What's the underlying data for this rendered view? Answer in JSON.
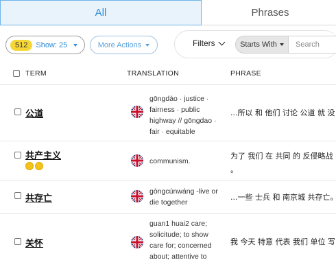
{
  "tabs": {
    "all": "All",
    "phrases": "Phrases"
  },
  "toolbar": {
    "count": "512",
    "show_label": "Show: 25",
    "more_actions": "More Actions",
    "filters": "Filters",
    "starts_with": "Starts With",
    "search_placeholder": "Search"
  },
  "columns": {
    "term": "TERM",
    "translation": "TRANSLATION",
    "phrase": "PHRASE"
  },
  "rows": [
    {
      "term": "公道",
      "translation": [
        "gōngdào · justice ·",
        "fairness · public",
        "highway // gōngdao ·",
        "fair · equitable"
      ],
      "phrase": [
        "...所以 和 他们 讨论 公道 就 没"
      ]
    },
    {
      "term": "共产主义",
      "translation": [
        "communism."
      ],
      "phrase": [
        "为了 我们 在 共同 的 反侵略战",
        "。"
      ]
    },
    {
      "term": "共存亡",
      "translation": [
        "gòngcúnwáng -live or",
        "die together"
      ],
      "phrase": [
        "...一些 士兵 和 南京城 共存亡。"
      ]
    },
    {
      "term": "关怀",
      "translation": [
        "guan1 huai2 care;",
        "solicitude; to show",
        "care for; concerned",
        "about; attentive to"
      ],
      "phrase": [
        "我 今天 特意 代表 我们 单位 写"
      ]
    }
  ],
  "colors": {
    "accent": "#2a8ad8",
    "badge": "#f5d635",
    "coin": "#f3c21b"
  },
  "icons": {
    "flag": "uk-flag-icon",
    "coin": "coin-icon"
  }
}
